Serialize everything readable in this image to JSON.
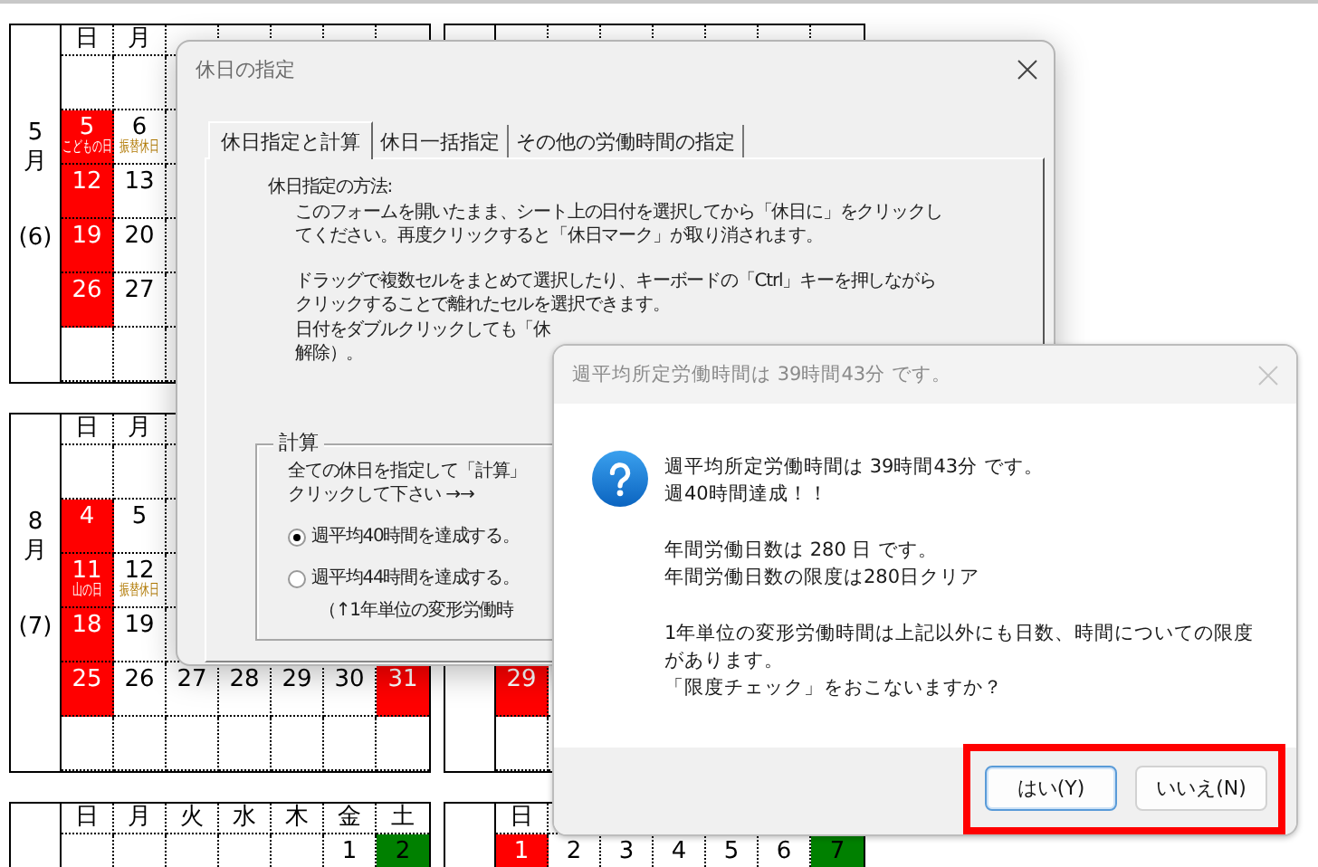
{
  "calendars": [
    {
      "kind": "calendar",
      "month": "5",
      "month_unit": "月",
      "count": "(6)",
      "headers": [
        "日",
        "月"
      ],
      "weeks": [
        {
          "kind": "week",
          "cells": [
            {
              "kind": "blank"
            },
            {
              "kind": "blank"
            }
          ]
        },
        {
          "kind": "week",
          "cells": [
            {
              "kind": "day",
              "day": "5",
              "color": "#ff0000",
              "note": "こどもの日"
            },
            {
              "kind": "day",
              "day": "6",
              "note": "振替休日"
            }
          ]
        },
        {
          "kind": "week",
          "cells": [
            {
              "kind": "day",
              "day": "12",
              "color": "#ff0000"
            },
            {
              "kind": "day",
              "day": "13"
            }
          ]
        },
        {
          "kind": "week",
          "cells": [
            {
              "kind": "day",
              "day": "19",
              "color": "#ff0000"
            },
            {
              "kind": "day",
              "day": "20"
            }
          ]
        },
        {
          "kind": "week",
          "cells": [
            {
              "kind": "day",
              "day": "26",
              "color": "#ff0000"
            },
            {
              "kind": "day",
              "day": "27"
            }
          ]
        },
        {
          "kind": "week",
          "cells": [
            {
              "kind": "blank"
            },
            {
              "kind": "blank"
            }
          ]
        }
      ]
    },
    {
      "kind": "calendar"
    },
    {
      "kind": "calendar",
      "month": "8",
      "month_unit": "月",
      "count": "(7)",
      "headers": [
        "日",
        "月"
      ],
      "weeks": [
        {
          "kind": "week",
          "cells": [
            {
              "kind": "blank"
            },
            {
              "kind": "blank"
            }
          ]
        },
        {
          "kind": "week",
          "cells": [
            {
              "kind": "day",
              "day": "4",
              "color": "#ff0000"
            },
            {
              "kind": "day",
              "day": "5"
            }
          ]
        },
        {
          "kind": "week",
          "cells": [
            {
              "kind": "day",
              "day": "11",
              "color": "#ff0000",
              "note": "山の日"
            },
            {
              "kind": "day",
              "day": "12",
              "note": "振替休日"
            }
          ]
        },
        {
          "kind": "week",
          "cells": [
            {
              "kind": "day",
              "day": "18",
              "color": "#ff0000"
            },
            {
              "kind": "day",
              "day": "19"
            }
          ]
        },
        {
          "kind": "week",
          "cells": [
            {
              "kind": "day",
              "day": "25",
              "color": "#ff0000"
            },
            {
              "kind": "day",
              "day": "26"
            },
            {
              "kind": "day",
              "day": "27"
            },
            {
              "kind": "day",
              "day": "28"
            },
            {
              "kind": "day",
              "day": "29"
            },
            {
              "kind": "day",
              "day": "30"
            },
            {
              "kind": "day",
              "day": "31",
              "color": "#ff0000"
            }
          ]
        },
        {
          "kind": "week",
          "cells": [
            {
              "kind": "blank"
            },
            {
              "kind": "blank"
            },
            {
              "kind": "blank"
            },
            {
              "kind": "blank"
            },
            {
              "kind": "blank"
            },
            {
              "kind": "blank"
            },
            {
              "kind": "blank"
            }
          ]
        }
      ]
    },
    {
      "kind": "calendar",
      "weeks": [
        {
          "kind": "covered"
        },
        {
          "kind": "covered"
        },
        {
          "kind": "covered"
        },
        {
          "kind": "covered"
        },
        {
          "kind": "week",
          "cells": [
            {
              "kind": "day",
              "day": "29",
              "color": "#ff0000"
            }
          ]
        },
        {
          "kind": "week",
          "cells": [
            {
              "kind": "blank"
            }
          ]
        }
      ]
    },
    {
      "kind": "calendar",
      "headers": [
        "日",
        "月",
        "火",
        "水",
        "木",
        "金",
        "土"
      ],
      "weeks": [
        {
          "kind": "week",
          "cells": [
            {
              "kind": "blank"
            },
            {
              "kind": "blank"
            },
            {
              "kind": "blank"
            },
            {
              "kind": "blank"
            },
            {
              "kind": "blank"
            },
            {
              "kind": "day",
              "day": "1"
            },
            {
              "kind": "day",
              "day": "2",
              "color": "#008000"
            }
          ]
        }
      ]
    },
    {
      "kind": "calendar",
      "headers": [
        "日"
      ],
      "weeks": [
        {
          "kind": "week",
          "cells": [
            {
              "kind": "day",
              "day": "1",
              "color": "#ff0000"
            },
            {
              "kind": "day",
              "day": "2"
            },
            {
              "kind": "day",
              "day": "3"
            },
            {
              "kind": "day",
              "day": "4"
            },
            {
              "kind": "day",
              "day": "5"
            },
            {
              "kind": "day",
              "day": "6"
            },
            {
              "kind": "day",
              "day": "7",
              "color": "#008000"
            }
          ]
        }
      ]
    }
  ],
  "holiday_dialog": {
    "title": "休日の指定",
    "close_disabled": false,
    "tabs": [
      {
        "label": "休日指定と計算",
        "selected": true
      },
      {
        "label": "休日一括指定",
        "selected": false
      },
      {
        "label": "その他の労働時間の指定",
        "selected": false
      }
    ],
    "instructions": {
      "heading": "休日指定の方法:",
      "paragraphs": [
        [
          "このフォームを開いたまま、シート上の日付を選択してから「休日に」をクリックし",
          "てください。再度クリックすると「休日マーク」が取り消されます。"
        ],
        [
          "ドラッグで複数セルをまとめて選択したり、キーボードの「Ctrl」キーを押しながら",
          "クリックすることで離れたセルを選択できます。"
        ],
        [
          "日付をダブルクリックしても「休",
          "解除）。"
        ]
      ]
    },
    "calc_group": {
      "label": "計算",
      "lines": [
        "全ての休日を指定して「計算」",
        "クリックして下さい →→"
      ],
      "options": [
        {
          "label": "週平均40時間を達成する。",
          "selected": true
        },
        {
          "label": "週平均44時間を達成する。",
          "selected": false
        }
      ],
      "note": "（↑1年単位の変形労働時"
    }
  },
  "message_box": {
    "title": "週平均所定労働時間は 39時間43分 です。",
    "close_disabled": true,
    "highlight": true,
    "paragraphs": [
      [
        "週平均所定労働時間は 39時間43分 です。",
        "週40時間達成！！"
      ],
      [
        "年間労働日数は 280 日 です。",
        "年間労働日数の限度は280日クリア"
      ],
      [
        "1年単位の変形労働時間は上記以外にも日数、時間についての限度があります。",
        "「限度チェック」をおこないますか？"
      ]
    ],
    "buttons": [
      {
        "label": "はい(Y)",
        "focused": true
      },
      {
        "label": "いいえ(N)",
        "focused": false
      }
    ]
  }
}
